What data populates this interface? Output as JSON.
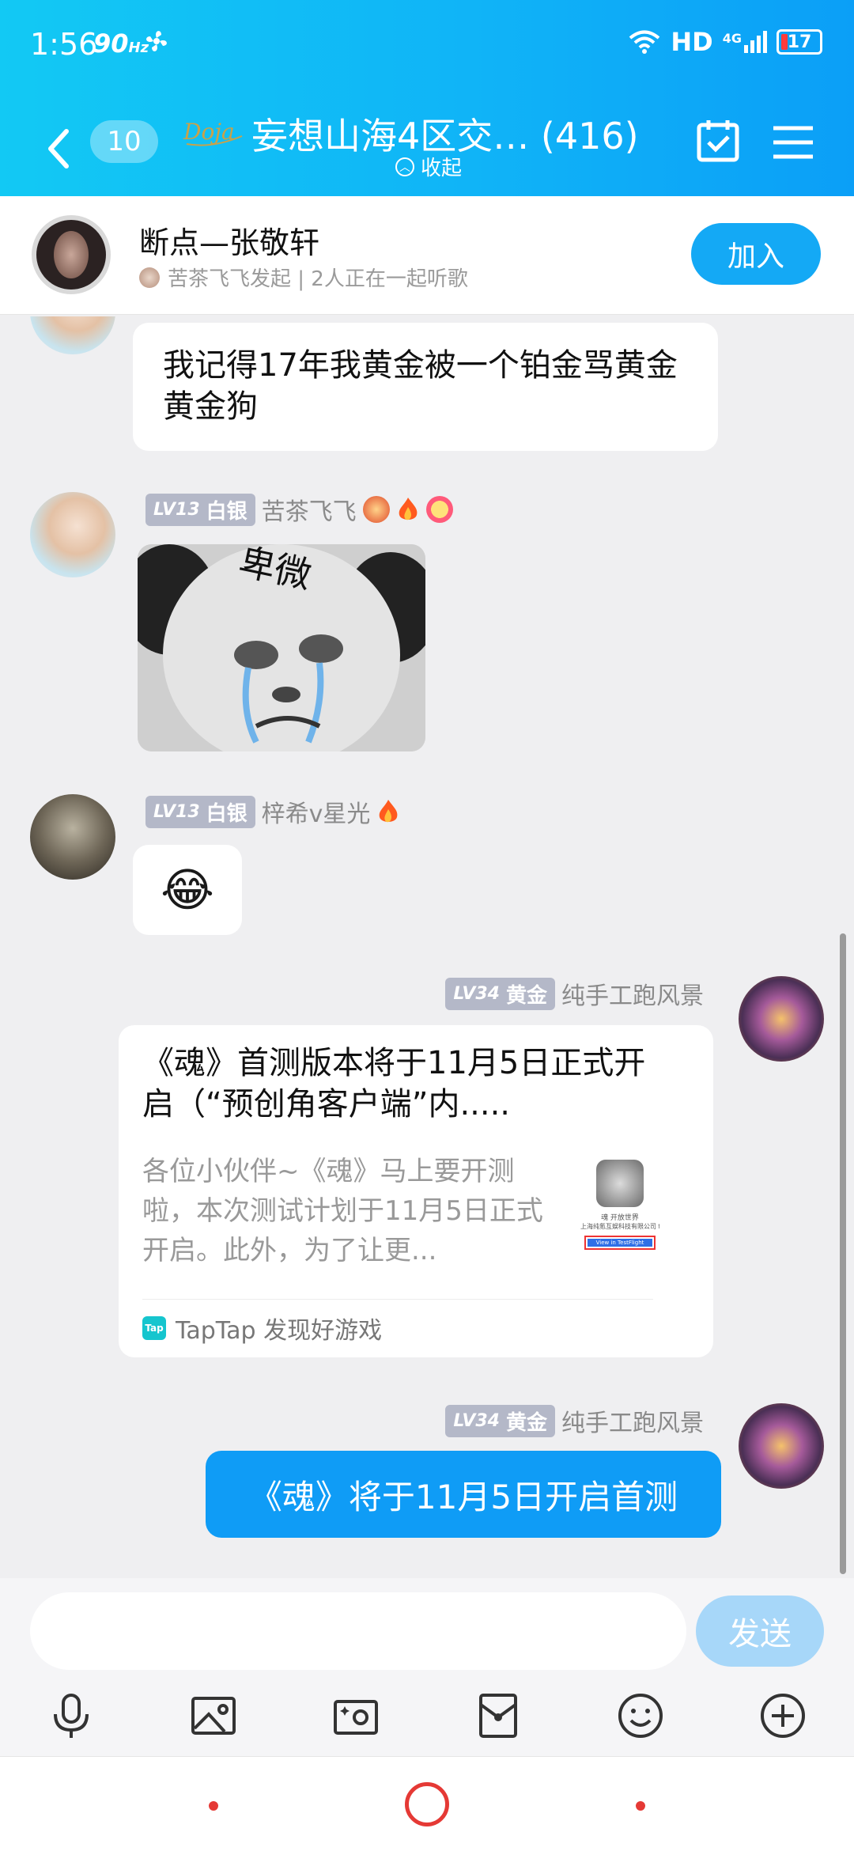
{
  "status_bar": {
    "time": "1:56",
    "refresh": "90",
    "refresh_unit": "Hz",
    "network": "HD",
    "signal": "4G",
    "battery": "17"
  },
  "header": {
    "unread_count": "10",
    "logo_text": "Doja",
    "group_title": "妄想山海4区交… (416)",
    "collapse_label": "收起"
  },
  "music": {
    "song_title": "断点—张敬轩",
    "started_by": "苦茶飞飞发起 | 2人正在一起听歌",
    "join_label": "加入"
  },
  "messages": [
    {
      "text": "我记得17年我黄金被一个铂金骂黄金黄金狗"
    },
    {
      "level": "LV13",
      "rank": "白银",
      "sender": "苦茶飞飞",
      "sticker_text": "卑微"
    },
    {
      "level": "LV13",
      "rank": "白银",
      "sender": "梓希v星光",
      "emoji": "😂"
    },
    {
      "level": "LV34",
      "rank": "黄金",
      "sender": "纯手工跑风景",
      "card_title": "《魂》首测版本将于11月5日正式开启（“预创角客户端”内.....",
      "card_desc": "各位小伙伴~《魂》马上要开测啦，本次测试计划于11月5日正式开启。此外，为了让更...",
      "card_thumb_title": "魂 开放世界",
      "card_thumb_company": "上海纯氪互娱科技有限公司 for iOS",
      "card_thumb_button": "View in TestFlight",
      "card_source_logo": "Tap",
      "card_source": "TapTap 发现好游戏"
    },
    {
      "level": "LV34",
      "rank": "黄金",
      "sender": "纯手工跑风景",
      "text": "《魂》将于11月5日开启首测"
    }
  ],
  "composer": {
    "placeholder": "",
    "send_label": "发送"
  },
  "colors": {
    "header_start": "#12c9f4",
    "header_end": "#0b9ff7",
    "accent": "#0f9cf6",
    "send_disabled": "#a7d7f9"
  }
}
